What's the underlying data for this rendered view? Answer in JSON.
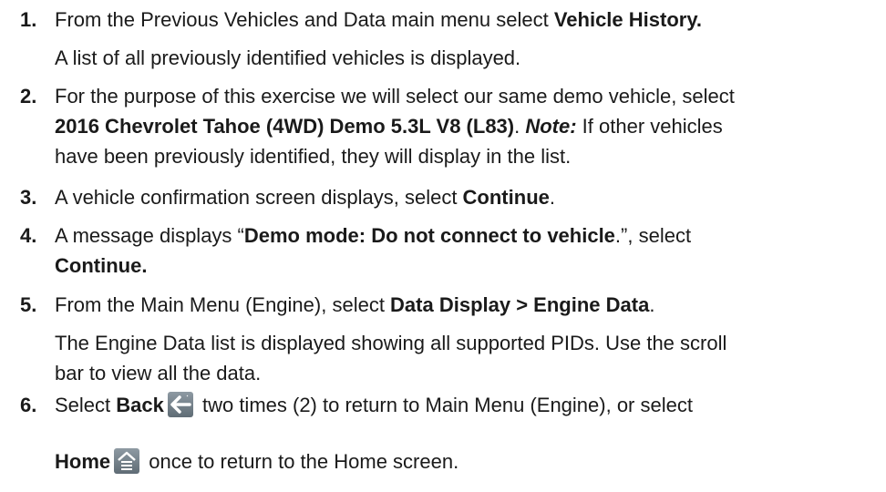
{
  "steps": [
    {
      "num": "1.",
      "parts": [
        "From the Previous Vehicles and Data main menu select ",
        "Vehicle History."
      ],
      "sub": "A list of all previously identified vehicles is displayed."
    },
    {
      "num": "2.",
      "line1": "For the purpose of this exercise we will select our same demo vehicle, select",
      "vehicle": "2016 Chevrolet Tahoe (4WD) Demo 5.3L V8 (L83)",
      "period": ". ",
      "note_label": "Note:",
      "note_rest": " If other vehicles",
      "line3": "have been previously identified, they will display in the list."
    },
    {
      "num": "3.",
      "text": "A vehicle confirmation screen displays, select ",
      "bold": "Continue",
      "end": "."
    },
    {
      "num": "4.",
      "pre": "A message displays “",
      "bold": "Demo mode: Do not connect to vehicle",
      "post": ".”, select",
      "bold2": "Continue."
    },
    {
      "num": "5.",
      "pre": "From the Main Menu (Engine), select ",
      "bold": "Data Display > Engine Data",
      "end": ".",
      "sub1": "The Engine Data list is displayed showing all supported PIDs. Use the scroll",
      "sub2": "bar to view all the data."
    },
    {
      "num": "6.",
      "pre": "Select ",
      "bold": "Back",
      "mid": " two times (2) to return to Main Menu (Engine), or select",
      "bold2": "Home",
      "end": " once to return to the Home screen."
    }
  ],
  "icons": {
    "back": "back-arrow-icon",
    "home": "home-icon"
  },
  "colors": {
    "icon_bg": "#6f7c86",
    "icon_fg": "#ffffff"
  }
}
